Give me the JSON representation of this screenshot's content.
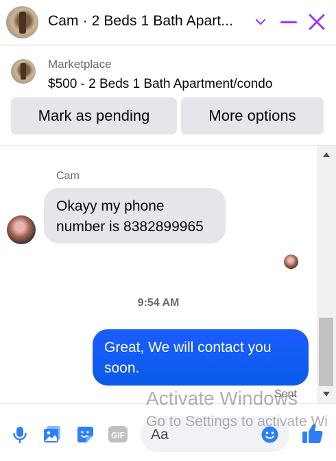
{
  "header": {
    "title": "Cam · 2 Beds 1 Bath Apart...",
    "accent_color": "#a033ff"
  },
  "marketplace": {
    "label": "Marketplace",
    "listing": "$500 - 2 Beds 1 Bath Apartment/condo"
  },
  "actions": {
    "mark_pending": "Mark as pending",
    "more_options": "More options"
  },
  "messages": {
    "sender_name": "Cam",
    "incoming_text": "Okayy my phone number is 8382899965",
    "timestamp": "9:54 AM",
    "outgoing_text": "Great, We will contact you soon.",
    "status": "Sent",
    "outgoing_color": "#0a5ae8"
  },
  "composer": {
    "placeholder": "Aa",
    "icons": [
      "microphone-icon",
      "photo-icon",
      "sticker-icon",
      "gif-icon",
      "emoji-icon",
      "thumbs-up-icon"
    ],
    "gif_label": "GIF"
  },
  "watermark": {
    "line1": "Activate Windows",
    "line2": "Go to Settings to activate Wi"
  }
}
